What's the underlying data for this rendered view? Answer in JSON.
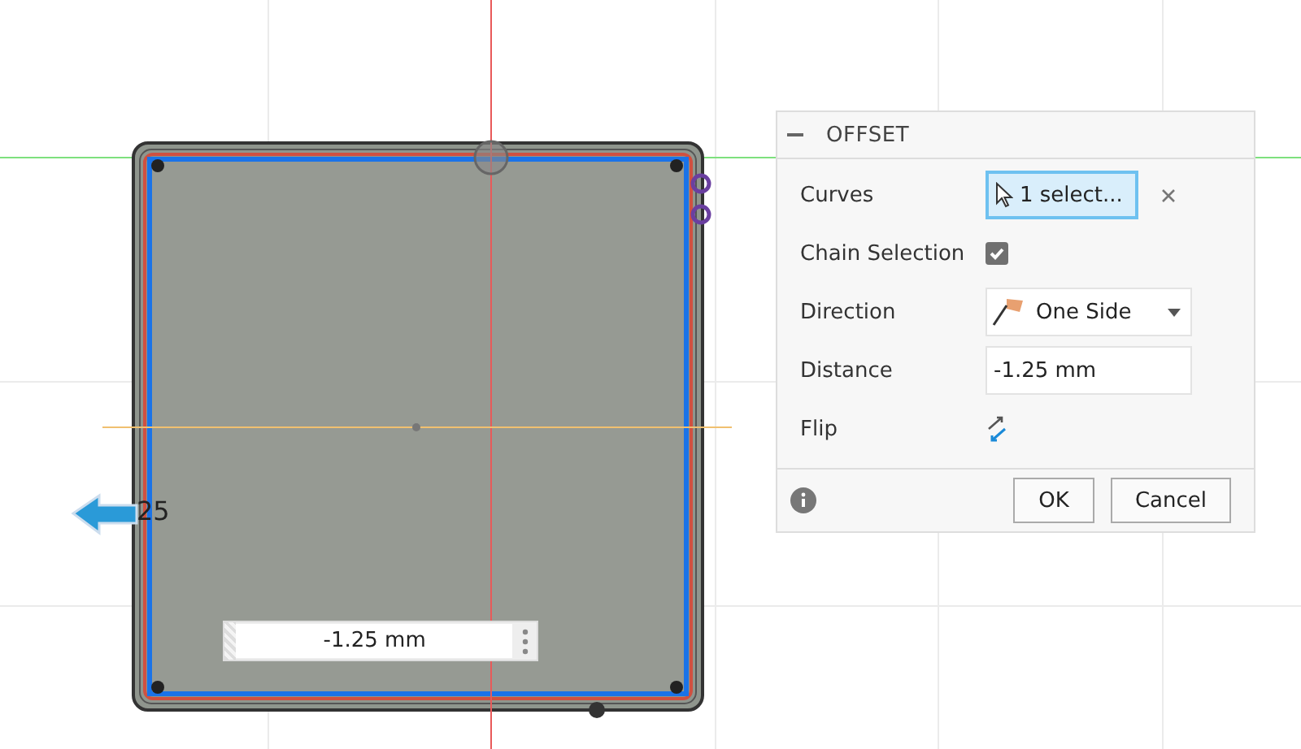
{
  "canvas": {
    "dimension_label": "25",
    "dimension_input": {
      "value": "-1.25 mm"
    }
  },
  "dialog": {
    "title": "OFFSET",
    "expanded": true,
    "rows": [
      {
        "kind": "selection",
        "label": "Curves",
        "value": "1 select..."
      },
      {
        "kind": "checkbox",
        "label": "Chain Selection",
        "checked": true
      },
      {
        "kind": "dropdown",
        "label": "Direction",
        "value": "One Side"
      },
      {
        "kind": "input",
        "label": "Distance",
        "value": "-1.25 mm"
      },
      {
        "kind": "flip",
        "label": "Flip"
      }
    ],
    "buttons": [
      "OK",
      "Cancel"
    ]
  }
}
